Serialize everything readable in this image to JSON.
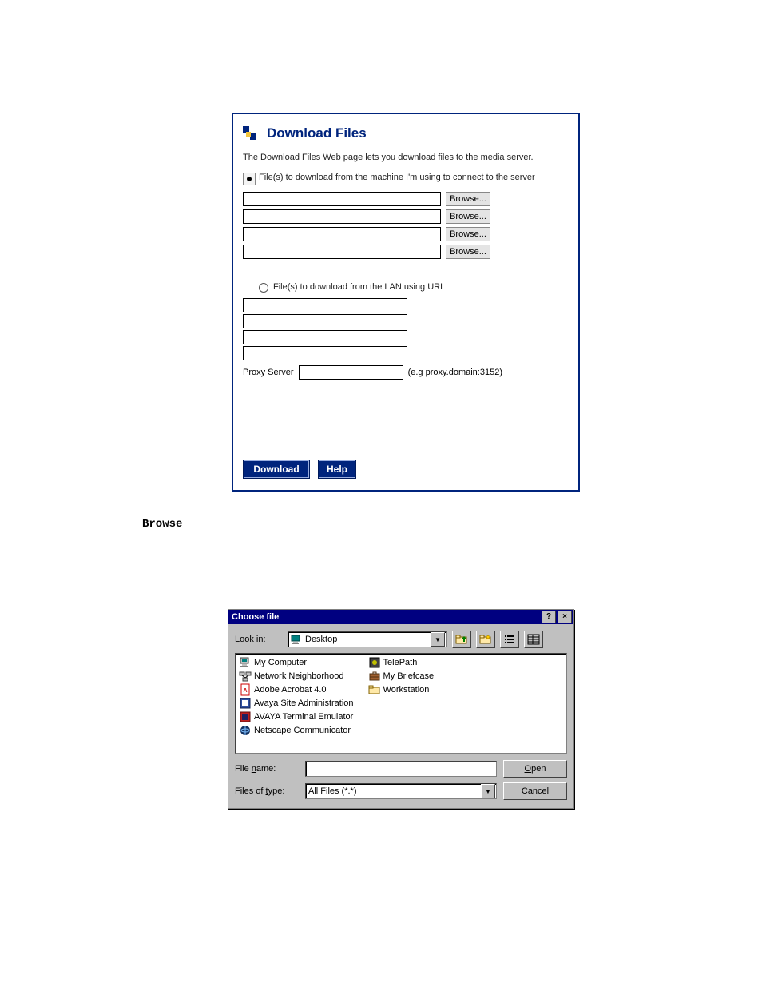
{
  "download_panel": {
    "title": "Download Files",
    "intro": "The Download Files Web page lets you download files to the media server.",
    "option_machine": {
      "label": "File(s) to download from the machine I'm using to connect to the server",
      "selected": true,
      "file_fields": [
        {
          "value": "",
          "browse_label": "Browse..."
        },
        {
          "value": "",
          "browse_label": "Browse..."
        },
        {
          "value": "",
          "browse_label": "Browse..."
        },
        {
          "value": "",
          "browse_label": "Browse..."
        }
      ]
    },
    "option_lan": {
      "label": "File(s) to download from the LAN using URL",
      "selected": false,
      "url_fields": [
        "",
        "",
        "",
        ""
      ],
      "proxy": {
        "label": "Proxy Server",
        "value": "",
        "hint": "(e.g proxy.domain:3152)"
      }
    },
    "buttons": {
      "download": "Download",
      "help": "Help"
    }
  },
  "browse_heading": "Browse",
  "choose_file_dialog": {
    "title": "Choose file",
    "lookin_label": {
      "pre": "Look ",
      "u": "i",
      "post": "n:"
    },
    "lookin_value": "Desktop",
    "toolbar": [
      "up-one-level-icon",
      "new-folder-icon",
      "list-view-icon",
      "details-view-icon"
    ],
    "files_col1": [
      {
        "icon": "computer-icon",
        "name": "My Computer"
      },
      {
        "icon": "network-icon",
        "name": "Network Neighborhood"
      },
      {
        "icon": "pdf-icon",
        "name": "Adobe Acrobat 4.0"
      },
      {
        "icon": "app-icon",
        "name": "Avaya Site Administration"
      },
      {
        "icon": "app-icon",
        "name": "AVAYA Terminal Emulator"
      },
      {
        "icon": "netscape-icon",
        "name": "Netscape Communicator"
      }
    ],
    "files_col2": [
      {
        "icon": "app-icon",
        "name": "TelePath"
      },
      {
        "icon": "briefcase-icon",
        "name": "My Briefcase"
      },
      {
        "icon": "folder-icon",
        "name": "Workstation"
      }
    ],
    "filename_label": {
      "pre": "File ",
      "u": "n",
      "post": "ame:"
    },
    "filename_value": "",
    "filetype_label": {
      "pre": "Files of ",
      "u": "t",
      "post": "ype:"
    },
    "filetype_value": "All Files (*.*)",
    "open_btn": {
      "u": "O",
      "post": "pen"
    },
    "cancel_btn": "Cancel"
  }
}
